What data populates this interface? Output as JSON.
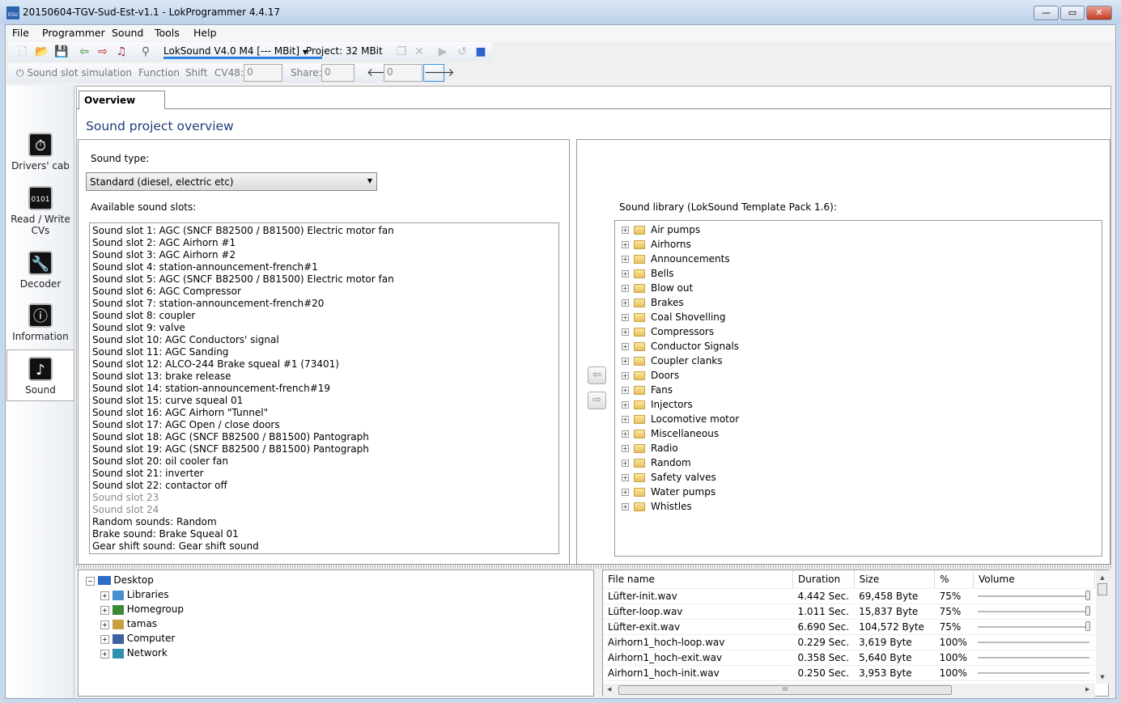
{
  "window": {
    "title": "20150604-TGV-Sud-Est-v1.1 - LokProgrammer 4.4.17",
    "logo": "ESU",
    "minimize": "—",
    "maximize": "▭",
    "close": "✕"
  },
  "menu": [
    "File",
    "Programmer",
    "Sound",
    "Tools",
    "Help"
  ],
  "toolbar1": {
    "decoder_select": "LokSound V4.0 M4 [--- MBit]",
    "project_label": "Project:",
    "project_value": "32 MBit"
  },
  "toolbar2": {
    "sound_slot_simulation": "Sound slot simulation",
    "function": "Function",
    "shift": "Shift",
    "cv48_label": "CV48:",
    "cv48_value": "0",
    "share_label": "Share:",
    "share_value": "0",
    "nav_value": "0"
  },
  "sidebar": [
    {
      "label": "Drivers' cab",
      "icon": "drivers-cab-icon"
    },
    {
      "label": "Read / Write CVs",
      "icon": "read-write-cvs-icon"
    },
    {
      "label": "Decoder",
      "icon": "decoder-icon"
    },
    {
      "label": "Information",
      "icon": "information-icon"
    },
    {
      "label": "Sound",
      "icon": "sound-icon",
      "selected": true
    }
  ],
  "tab": "Overview",
  "heading": "Sound project overview",
  "sound_type_label": "Sound type:",
  "sound_type_value": "Standard (diesel, electric etc)",
  "slots_label": "Available sound slots:",
  "slots": [
    {
      "t": "Sound slot 1: AGC (SNCF B82500 / B81500) Electric motor fan"
    },
    {
      "t": "Sound slot 2: AGC Airhorn #1"
    },
    {
      "t": "Sound slot 3: AGC Airhorn #2"
    },
    {
      "t": "Sound slot 4: station-announcement-french#1"
    },
    {
      "t": "Sound slot 5: AGC (SNCF B82500 / B81500) Electric motor fan"
    },
    {
      "t": "Sound slot 6: AGC Compressor"
    },
    {
      "t": "Sound slot 7: station-announcement-french#20"
    },
    {
      "t": "Sound slot 8: coupler"
    },
    {
      "t": "Sound slot 9: valve"
    },
    {
      "t": "Sound slot 10: AGC Conductors' signal"
    },
    {
      "t": "Sound slot 11: AGC Sanding"
    },
    {
      "t": "Sound slot 12: ALCO-244 Brake squeal #1 (73401)"
    },
    {
      "t": "Sound slot 13: brake release"
    },
    {
      "t": "Sound slot 14: station-announcement-french#19"
    },
    {
      "t": "Sound slot 15: curve squeal 01"
    },
    {
      "t": "Sound slot 16: AGC Airhorn \"Tunnel\""
    },
    {
      "t": "Sound slot 17: AGC Open / close doors"
    },
    {
      "t": "Sound slot 18: AGC (SNCF B82500 / B81500) Pantograph"
    },
    {
      "t": "Sound slot 19: AGC (SNCF B82500 / B81500) Pantograph"
    },
    {
      "t": "Sound slot 20: oil cooler fan"
    },
    {
      "t": "Sound slot 21: inverter"
    },
    {
      "t": "Sound slot 22: contactor off"
    },
    {
      "t": "Sound slot 23",
      "empty": true
    },
    {
      "t": "Sound slot 24",
      "empty": true
    },
    {
      "t": "Random sounds: Random"
    },
    {
      "t": "Brake sound: Brake Squeal 01"
    },
    {
      "t": "Gear shift sound: Gear shift sound"
    }
  ],
  "library_label": "Sound library (LokSound Template Pack 1.6):",
  "library": [
    "Air pumps",
    "Airhorns",
    "Announcements",
    "Bells",
    "Blow out",
    "Brakes",
    "Coal Shovelling",
    "Compressors",
    "Conductor Signals",
    "Coupler clanks",
    "Doors",
    "Fans",
    "Injectors",
    "Locomotive motor",
    "Miscellaneous",
    "Radio",
    "Random",
    "Safety valves",
    "Water pumps",
    "Whistles"
  ],
  "arrows": {
    "left": "⇦",
    "right": "⇨"
  },
  "file_tree": {
    "root": "Desktop",
    "children": [
      "Libraries",
      "Homegroup",
      "tamas",
      "Computer",
      "Network"
    ]
  },
  "files": {
    "columns": [
      "File name",
      "Duration",
      "Size",
      "%",
      "Volume"
    ],
    "rows": [
      [
        "Lüfter-init.wav",
        "4.442 Sec.",
        "69,458 Byte",
        "75%"
      ],
      [
        "Lüfter-loop.wav",
        "1.011 Sec.",
        "15,837 Byte",
        "75%"
      ],
      [
        "Lüfter-exit.wav",
        "6.690 Sec.",
        "104,572 Byte",
        "75%"
      ],
      [
        "Airhorn1_hoch-loop.wav",
        "0.229 Sec.",
        "3,619 Byte",
        "100%"
      ],
      [
        "Airhorn1_hoch-exit.wav",
        "0.358 Sec.",
        "5,640 Byte",
        "100%"
      ],
      [
        "Airhorn1_hoch-init.wav",
        "0.250 Sec.",
        "3,953 Byte",
        "100%"
      ]
    ],
    "volume_percent": [
      75,
      75,
      75,
      100,
      100,
      100
    ]
  },
  "scroll_glyphs": {
    "up": "▲",
    "down": "▼",
    "left": "◀",
    "right": "▶",
    "grip": "III"
  }
}
